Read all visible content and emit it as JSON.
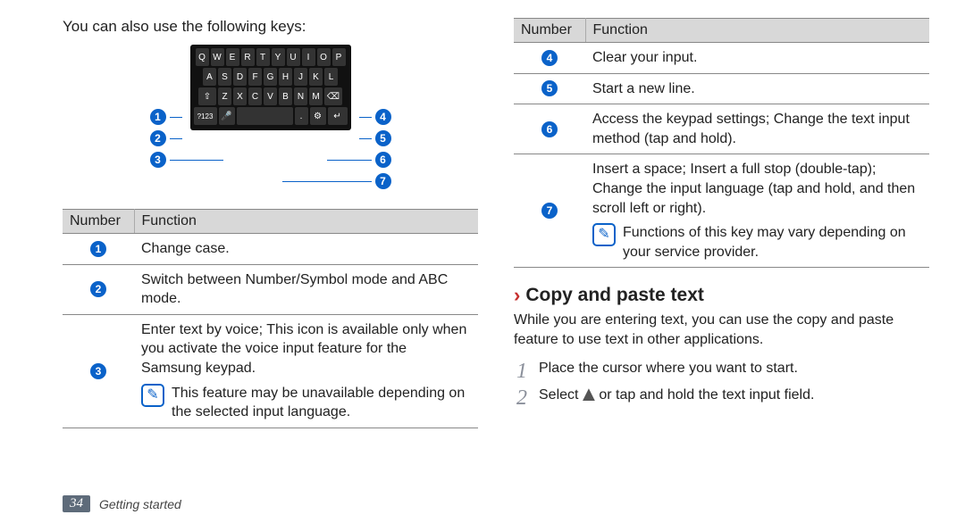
{
  "intro": "You can also use the following keys:",
  "keyboard": {
    "row1": [
      "Q",
      "W",
      "E",
      "R",
      "T",
      "Y",
      "U",
      "I",
      "O",
      "P"
    ],
    "row2": [
      "A",
      "S",
      "D",
      "F",
      "G",
      "H",
      "J",
      "K",
      "L"
    ],
    "row3": [
      "Z",
      "X",
      "C",
      "V",
      "B",
      "N",
      "M"
    ],
    "shift": "⇧",
    "backspace": "⌫",
    "mode": "?123",
    "mic": "🎤",
    "space": " ",
    "dot": ".",
    "gear": "⚙",
    "enter": "↵"
  },
  "callouts": {
    "n1": "1",
    "n2": "2",
    "n3": "3",
    "n4": "4",
    "n5": "5",
    "n6": "6",
    "n7": "7"
  },
  "table_left": {
    "head_num": "Number",
    "head_fn": "Function",
    "rows": [
      {
        "num": "1",
        "fn": "Change case."
      },
      {
        "num": "2",
        "fn": "Switch between Number/Symbol mode and ABC mode."
      },
      {
        "num": "3",
        "fn": "Enter text by voice; This icon is available only when you activate the voice input feature for the Samsung keypad.",
        "note": "This feature may be unavailable depending on the selected input language."
      }
    ]
  },
  "table_right": {
    "head_num": "Number",
    "head_fn": "Function",
    "rows": [
      {
        "num": "4",
        "fn": "Clear your input."
      },
      {
        "num": "5",
        "fn": "Start a new line."
      },
      {
        "num": "6",
        "fn": "Access the keypad settings; Change the text input method (tap and hold)."
      },
      {
        "num": "7",
        "fn": "Insert a space; Insert a full stop (double-tap); Change the input language (tap and hold, and then scroll left or right).",
        "note": "Functions of this key may vary depending on your service provider."
      }
    ]
  },
  "section": {
    "title": "Copy and paste text",
    "body": "While you are entering text, you can use the copy and paste feature to use text in other applications.",
    "step1_num": "1",
    "step1": "Place the cursor where you want to start.",
    "step2_num": "2",
    "step2_a": "Select ",
    "step2_b": " or tap and hold the text input field."
  },
  "footer": {
    "page": "34",
    "section": "Getting started"
  }
}
